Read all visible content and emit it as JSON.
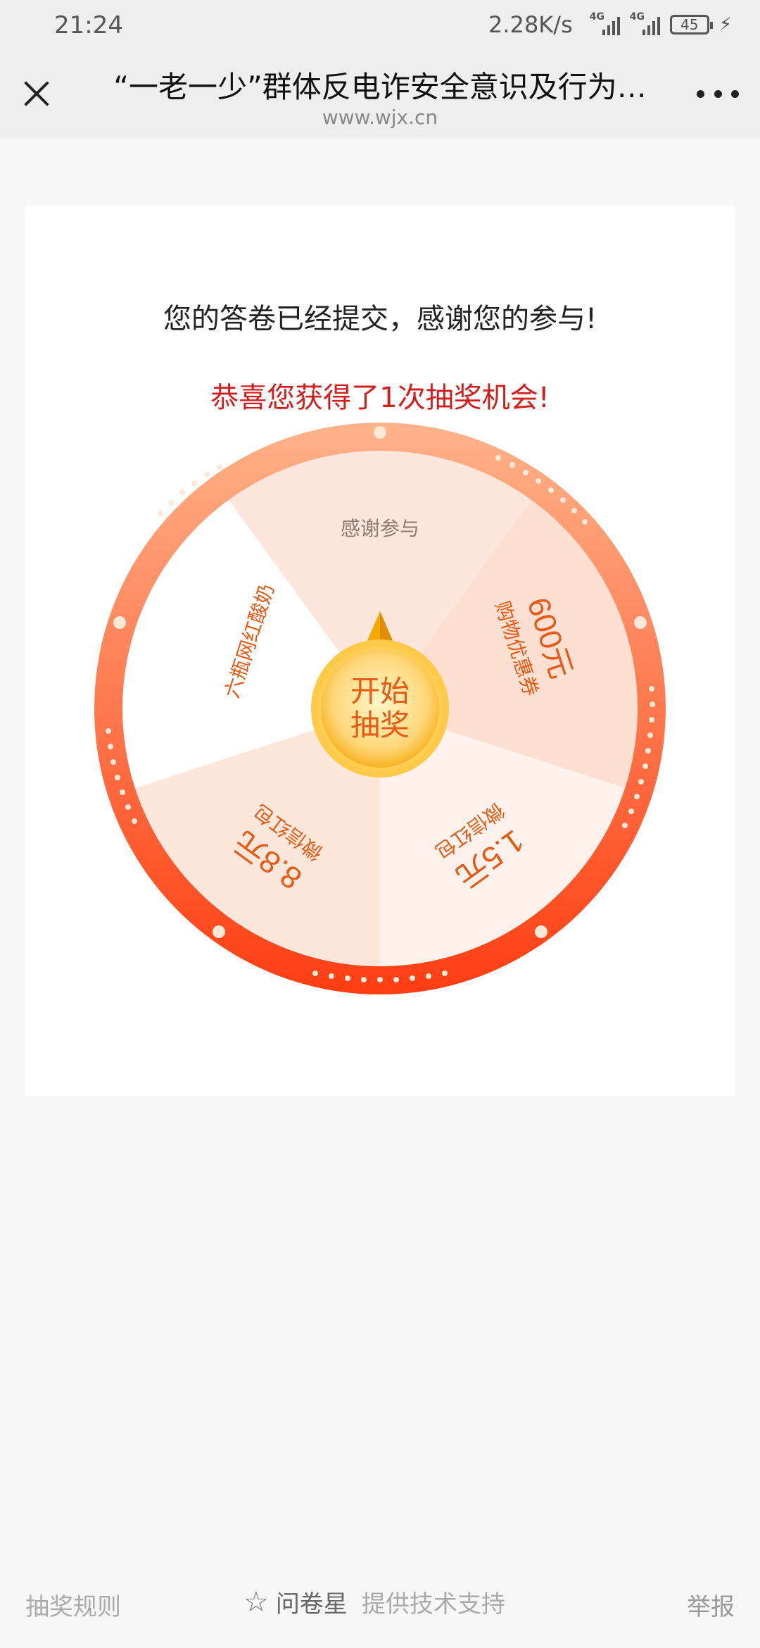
{
  "status_bar": {
    "time": "21:24",
    "net_speed": "2.28K/s",
    "signal_label_1": "4G",
    "signal_label_2": "4G",
    "battery": "45"
  },
  "nav": {
    "title": "“一老一少”群体反电诈安全意识及行为…",
    "url": "www.wjx.cn"
  },
  "card": {
    "thanks": "您的答卷已经提交，感谢您的参与!",
    "prize_chance": "恭喜您获得了1次抽奖机会!"
  },
  "wheel": {
    "center_line1": "开始",
    "center_line2": "抽奖",
    "segments": [
      {
        "label": "感谢参与"
      },
      {
        "label_big": "600元",
        "label_small": "购物优惠券"
      },
      {
        "label_big": "1.5元",
        "label_small": "微信红包"
      },
      {
        "label_big": "8.8元",
        "label_small": "微信红包"
      },
      {
        "label_small": "六瓶网红酸奶"
      }
    ],
    "colors": {
      "ring": "#ff6a2b",
      "accent_text": "#e55a14",
      "pointer": "#f6a800"
    }
  },
  "footer": {
    "rules": "抽奖规则",
    "brand": "问卷星",
    "support": "提供技术支持",
    "report": "举报"
  }
}
